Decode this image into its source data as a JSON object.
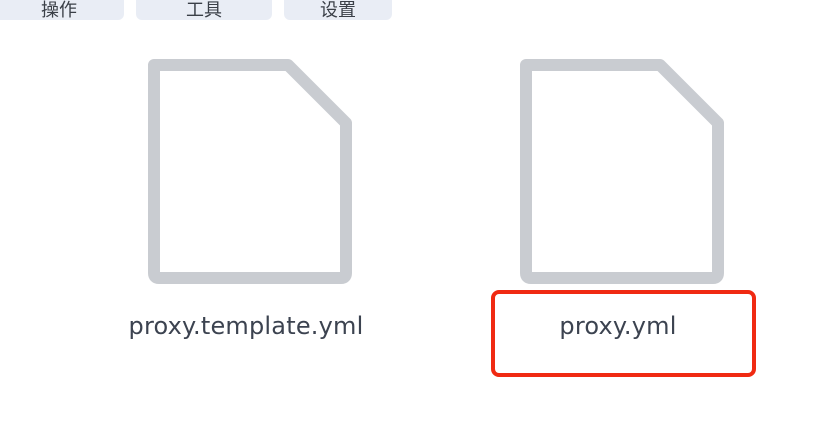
{
  "toolbar": {
    "buttons": [
      {
        "label": "操作"
      },
      {
        "label": "工具"
      },
      {
        "label": "设置"
      }
    ]
  },
  "files": [
    {
      "name": "proxy.template.yml",
      "icon": "file-icon",
      "highlighted": false
    },
    {
      "name": "proxy.yml",
      "icon": "file-icon",
      "highlighted": true
    }
  ],
  "colors": {
    "icon_stroke": "#c9ccd1",
    "highlight": "#f02a12",
    "toolbar_bg": "#e9edf5",
    "text": "#3c4350"
  }
}
